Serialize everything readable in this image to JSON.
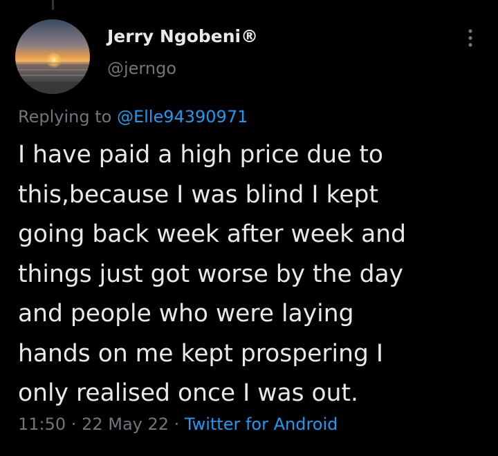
{
  "author": {
    "display_name": "Jerry Ngobeni®",
    "handle": "@jerngo",
    "avatar_icon": "sunset-beach-avatar"
  },
  "reply": {
    "prefix": "Replying to ",
    "target": "@Elle94390971"
  },
  "tweet": {
    "lines": [
      "I have paid a high price due to",
      "this,because I was blind I kept",
      "going back week after week and",
      "things just got worse by the day",
      "and people who were laying",
      "hands on me kept prospering I",
      "only realised once I was out."
    ]
  },
  "meta": {
    "time": "11:50",
    "sep1": " · ",
    "date": "22 May 22",
    "sep2": " · ",
    "source": "Twitter for Android"
  },
  "icons": {
    "more": "more-vertical-icon"
  },
  "colors": {
    "background": "#000000",
    "text": "#e7e9ea",
    "muted": "#71767b",
    "link": "#1d9bf0"
  }
}
